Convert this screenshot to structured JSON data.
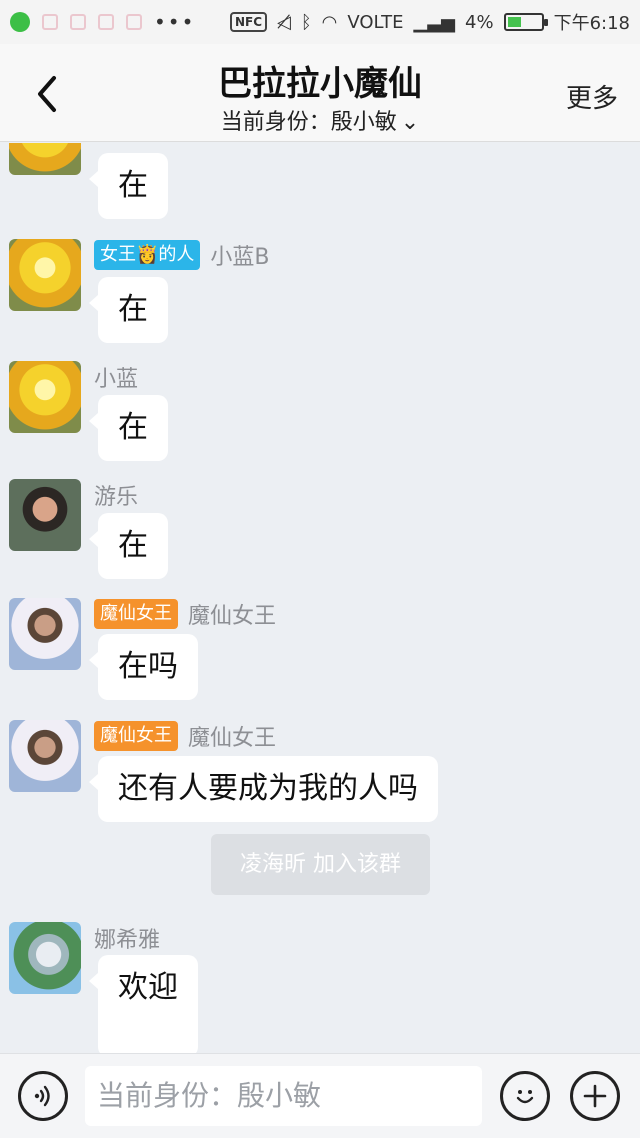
{
  "status_bar": {
    "nfc": "NFC",
    "network": "VOLTE",
    "battery": "4%",
    "time": "下午6:18",
    "more": "•••",
    "battery_level": 0.04
  },
  "header": {
    "title": "巴拉拉小魔仙",
    "identity": "当前身份：殷小敏",
    "more": "更多"
  },
  "messages": [
    {
      "sender": "",
      "badge": "",
      "text": "在"
    },
    {
      "sender": "小蓝B",
      "badge": "女王👸的人",
      "text": "在"
    },
    {
      "sender": "小蓝",
      "badge": "",
      "text": "在"
    },
    {
      "sender": "游乐",
      "badge": "",
      "text": "在"
    },
    {
      "sender": "魔仙女王",
      "badge": "魔仙女王",
      "text": "在吗"
    },
    {
      "sender": "魔仙女王",
      "badge": "魔仙女王",
      "text": "还有人要成为我的人吗"
    },
    {
      "sender": "娜希雅",
      "badge": "",
      "text": "欢迎"
    }
  ],
  "system_note": "凌海昕 加入该群",
  "input": {
    "placeholder": "当前身份：殷小敏"
  },
  "colors": {
    "accent_blue": "#2bb5e9",
    "accent_orange": "#f5922c",
    "background": "#eceff3"
  }
}
